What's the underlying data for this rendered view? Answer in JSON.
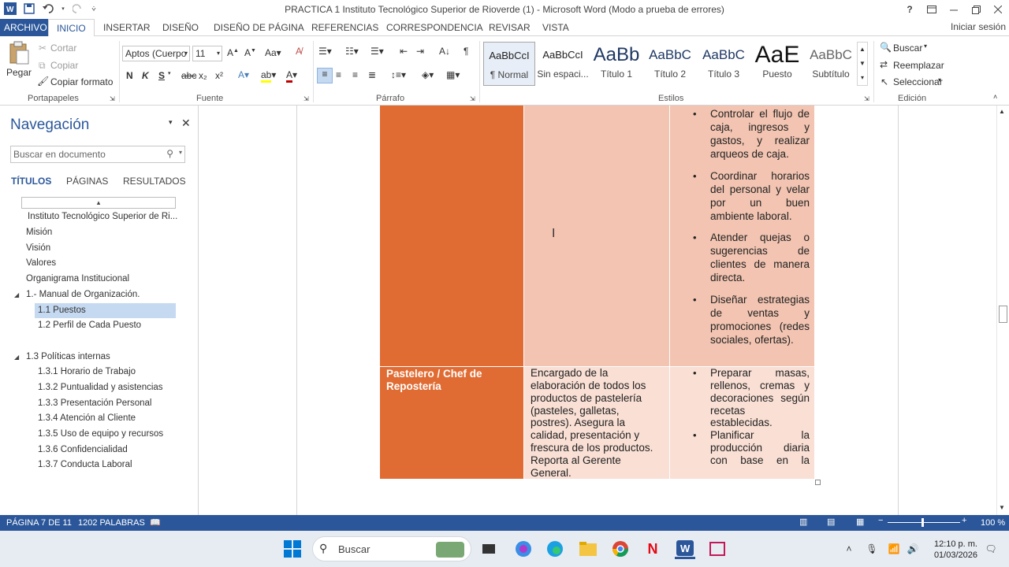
{
  "window": {
    "title": "PRACTICA  1 Instituto Tecnológico Superior de Rioverde (1) - Microsoft Word (Modo a prueba de errores)",
    "help": "?",
    "signin": "Iniciar sesión"
  },
  "tabs": [
    "ARCHIVO",
    "INICIO",
    "INSERTAR",
    "DISEÑO",
    "DISEÑO DE PÁGINA",
    "REFERENCIAS",
    "CORRESPONDENCIA",
    "REVISAR",
    "VISTA"
  ],
  "ribbon": {
    "clipboard": {
      "paste": "Pegar",
      "cut": "Cortar",
      "copy": "Copiar",
      "format_painter": "Copiar formato",
      "label": "Portapapeles"
    },
    "font": {
      "name": "Aptos (Cuerpo",
      "size": "11",
      "label": "Fuente",
      "bold": "N",
      "italic": "K",
      "underline": "S"
    },
    "paragraph": {
      "label": "Párrafo"
    },
    "styles": {
      "label": "Estilos",
      "items": [
        {
          "preview": "AaBbCcI",
          "name": "¶ Normal"
        },
        {
          "preview": "AaBbCcI",
          "name": "Sin espaci..."
        },
        {
          "preview": "AaBb",
          "name": "Título 1"
        },
        {
          "preview": "AaBbC",
          "name": "Título 2"
        },
        {
          "preview": "AaBbC",
          "name": "Título 3"
        },
        {
          "preview": "AaE",
          "name": "Puesto"
        },
        {
          "preview": "AaBbC",
          "name": "Subtítulo"
        }
      ]
    },
    "editing": {
      "find": "Buscar",
      "replace": "Reemplazar",
      "select": "Seleccionar",
      "label": "Edición"
    }
  },
  "nav": {
    "title": "Navegación",
    "search_placeholder": "Buscar en documento",
    "tabs": [
      "TÍTULOS",
      "PÁGINAS",
      "RESULTADOS"
    ],
    "items": [
      "Instituto Tecnológico Superior de Ri...",
      "Misión",
      "Visión",
      "Valores",
      "Organigrama Institucional",
      "1.- Manual de Organización.",
      "1.1 Puestos",
      "1.2 Perfil de Cada Puesto",
      "1.3 Políticas internas",
      "1.3.1 Horario de Trabajo",
      "1.3.2 Puntualidad y asistencias",
      "1.3.3 Presentación Personal",
      "1.3.4 Atención al Cliente",
      "1.3.5 Uso de equipo y recursos",
      "1.3.6 Confidencialidad",
      "1.3.7 Conducta Laboral"
    ]
  },
  "document": {
    "row1_bullets": [
      [
        "Controlar el flujo de",
        "caja, ingresos y",
        "gastos, y realizar",
        "arqueos de caja."
      ],
      [
        "Coordinar horarios",
        "del personal y velar",
        "por un buen",
        "ambiente laboral."
      ],
      [
        "Atender quejas o",
        "sugerencias de",
        "clientes de manera",
        "directa."
      ],
      [
        "Diseñar estrategias",
        "de ventas y",
        "promociones (redes",
        "sociales, ofertas)."
      ]
    ],
    "row2_title": [
      "Pastelero / Chef de",
      "Repostería"
    ],
    "row2_desc": [
      "Encargado de la",
      "elaboración de todos los",
      "productos de pastelería",
      "(pasteles, galletas,",
      "postres). Asegura la",
      "calidad, presentación y",
      "frescura de los productos.",
      "Reporta al Gerente",
      "General."
    ],
    "row2_bullets": [
      [
        "Preparar masas,",
        "rellenos, cremas y",
        "decoraciones según",
        "recetas",
        "establecidas."
      ],
      [
        "Planificar la",
        "producción diaria",
        "con base en la"
      ]
    ]
  },
  "status": {
    "page": "PÁGINA 7 DE 11",
    "words": "1202 PALABRAS",
    "zoom": "100 %"
  },
  "taskbar": {
    "search": "Buscar",
    "time": "12:10 p. m.",
    "date": "01/03/2026"
  }
}
